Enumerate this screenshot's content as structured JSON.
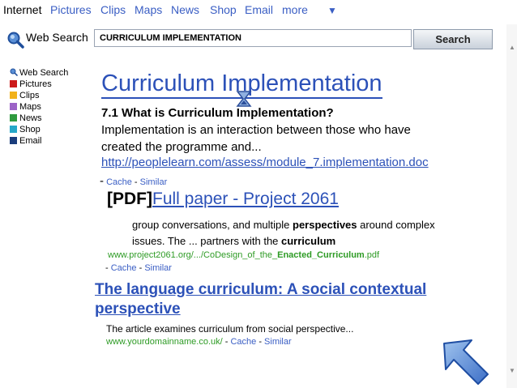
{
  "nav": {
    "internet": "Internet",
    "links": [
      "Pictures",
      "Clips",
      "Maps",
      "News",
      "Shop",
      "Email",
      "more"
    ],
    "more_arrow": "▼"
  },
  "search": {
    "label": "Web Search",
    "query": "CURRICULUM IMPLEMENTATION",
    "button": "Search"
  },
  "sidebar": {
    "items": [
      {
        "label": "Web Search",
        "icon": "search-icon"
      },
      {
        "label": "Pictures",
        "color": "#cc1a1a"
      },
      {
        "label": "Clips",
        "color": "#f2b21b"
      },
      {
        "label": "Maps",
        "color": "#9c63c7"
      },
      {
        "label": "News",
        "color": "#2f9a3e"
      },
      {
        "label": "Shop",
        "color": "#25a7c8"
      },
      {
        "label": "Email",
        "color": "#1a3d7c"
      }
    ]
  },
  "results": [
    {
      "title": "Curriculum Implementation",
      "snippet_heading": "7.1 What is Curriculum Implementation?",
      "snippet_lines": [
        "Implementation is an interaction between those who have",
        "created the programme and..."
      ],
      "url": "http://peoplelearn.com/assess/module_7.implementation.doc",
      "dash": "-",
      "cache": "Cache",
      "sep": "-",
      "similar": "Similar"
    },
    {
      "pdf_tag": "[PDF]",
      "title": "Full paper - Project 2061",
      "snippet_parts": [
        "group conversations, and multiple ",
        "perspectives",
        " around complex"
      ],
      "snippet_line2_parts": [
        "issues. The ... partners with the ",
        "curriculum"
      ],
      "url_pre": "www.project2061.org/.../CoDesign_of_the_",
      "url_bold": "Enacted_Curriculum",
      "url_post": ".pdf",
      "dash": "-",
      "cache": "Cache",
      "sep": "-",
      "similar": "Similar"
    },
    {
      "title": "The language curriculum: A social contextual perspective",
      "snippet": "The article examines curriculum from social perspective...",
      "url": "www.yourdomainname.co.uk/",
      "dash": " - ",
      "cache": "Cache",
      "sep": " - ",
      "similar": "Similar"
    }
  ],
  "colors": {
    "link_blue": "#2c51b8",
    "url_green": "#2e9b25"
  }
}
